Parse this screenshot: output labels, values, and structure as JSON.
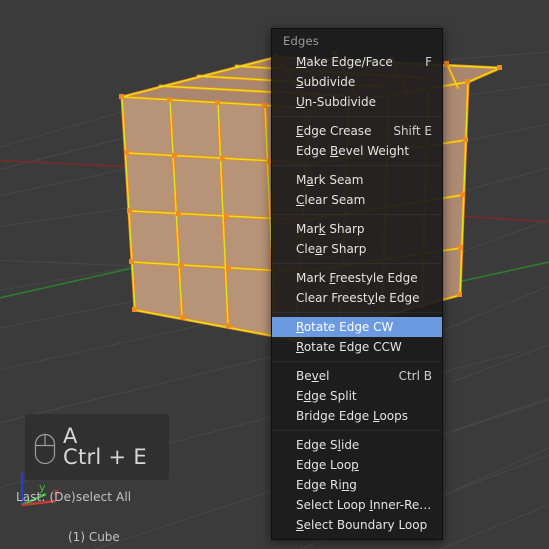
{
  "viewport": {
    "background_color": "#3b3b3b",
    "grid_color": "#4a4a4a",
    "axis_x_color": "#7a2a2a",
    "axis_y_color": "#2f7a2f",
    "object_face_color": "#b79377",
    "object_edge_color": "#d8d81f",
    "object_edge_outline_color": "#ef8b20",
    "object_vertex_color": "#ef8b20"
  },
  "overlay": {
    "mouse_icon": "mouse-icon",
    "key_line_1": "A",
    "key_line_2": "Ctrl + E"
  },
  "status": {
    "last_operation": "Last: (De)select All",
    "object_name": "(1) Cube"
  },
  "axis_gizmo": {
    "x_label": "x",
    "y_label": "y",
    "x_color": "#c33b3b",
    "y_color": "#3ac03a",
    "z_color": "#2b3ec0"
  },
  "menu": {
    "title": "Edges",
    "highlighted_index": 11,
    "highlight_color": "#6b9ae0",
    "items": [
      {
        "label": "Make Edge/Face",
        "underline": "M",
        "shortcut": "F",
        "separator_after": false
      },
      {
        "label": "Subdivide",
        "underline": "S",
        "shortcut": "",
        "separator_after": false
      },
      {
        "label": "Un-Subdivide",
        "underline": "U",
        "shortcut": "",
        "separator_after": true
      },
      {
        "label": "Edge Crease",
        "underline": "E",
        "shortcut": "Shift E",
        "separator_after": false
      },
      {
        "label": "Edge Bevel Weight",
        "underline": "B",
        "shortcut": "",
        "separator_after": true
      },
      {
        "label": "Mark Seam",
        "underline": "a",
        "shortcut": "",
        "separator_after": false
      },
      {
        "label": "Clear Seam",
        "underline": "C",
        "shortcut": "",
        "separator_after": true
      },
      {
        "label": "Mark Sharp",
        "underline": "k",
        "shortcut": "",
        "separator_after": false
      },
      {
        "label": "Clear Sharp",
        "underline": "a",
        "shortcut": "",
        "separator_after": true
      },
      {
        "label": "Mark Freestyle Edge",
        "underline": "F",
        "shortcut": "",
        "separator_after": false
      },
      {
        "label": "Clear Freestyle Edge",
        "underline": "y",
        "shortcut": "",
        "separator_after": true
      },
      {
        "label": "Rotate Edge CW",
        "underline": "R",
        "shortcut": "",
        "separator_after": false
      },
      {
        "label": "Rotate Edge CCW",
        "underline": "R",
        "shortcut": "",
        "separator_after": true
      },
      {
        "label": "Bevel",
        "underline": "v",
        "shortcut": "Ctrl B",
        "separator_after": false
      },
      {
        "label": "Edge Split",
        "underline": "d",
        "shortcut": "",
        "separator_after": false
      },
      {
        "label": "Bridge Edge Loops",
        "underline": "L",
        "shortcut": "",
        "separator_after": true
      },
      {
        "label": "Edge Slide",
        "underline": "l",
        "shortcut": "",
        "separator_after": false
      },
      {
        "label": "Edge Loop",
        "underline": "p",
        "shortcut": "",
        "separator_after": false
      },
      {
        "label": "Edge Ring",
        "underline": "n",
        "shortcut": "",
        "separator_after": false
      },
      {
        "label": "Select Loop Inner-Region",
        "underline": "I",
        "shortcut": "",
        "separator_after": false
      },
      {
        "label": "Select Boundary Loop",
        "underline": "S",
        "shortcut": "",
        "separator_after": false
      }
    ]
  }
}
